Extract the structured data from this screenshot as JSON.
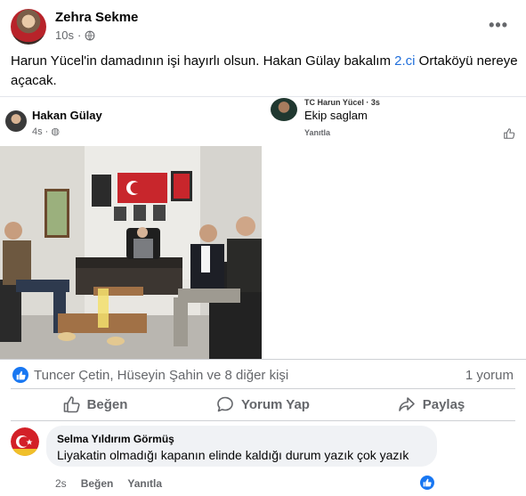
{
  "post": {
    "author": "Zehra Sekme",
    "time": "10s",
    "more_label": "•••",
    "text_before": "Harun Yücel'in damadının işi hayırlı olsun. Hakan Gülay bakalım ",
    "text_highlight": "2.ci",
    "text_after": " Ortaköyü nereye açacak."
  },
  "embedded": {
    "inner_post": {
      "author": "Hakan Gülay",
      "time": "4s"
    },
    "screenshot_comment": {
      "name": "TC Harun Yücel · 3s",
      "text": "Ekip saglam",
      "reply": "Yanıtla"
    }
  },
  "reactions": {
    "summary": "Tuncer Çetin, Hüseyin Şahin ve 8 diğer kişi",
    "comment_count": "1 yorum"
  },
  "actions": {
    "like": "Beğen",
    "comment": "Yorum Yap",
    "share": "Paylaş"
  },
  "comment": {
    "author": "Selma Yıldırım Görmüş",
    "text": "Liyakatin olmadığı kapanın elinde kaldığı durum yazık çok yazık",
    "time": "2s",
    "like_label": "Beğen",
    "reply_label": "Yanıtla"
  },
  "colors": {
    "accent": "#1877f2",
    "secondary_text": "#65676b",
    "link": "#216fdb"
  }
}
